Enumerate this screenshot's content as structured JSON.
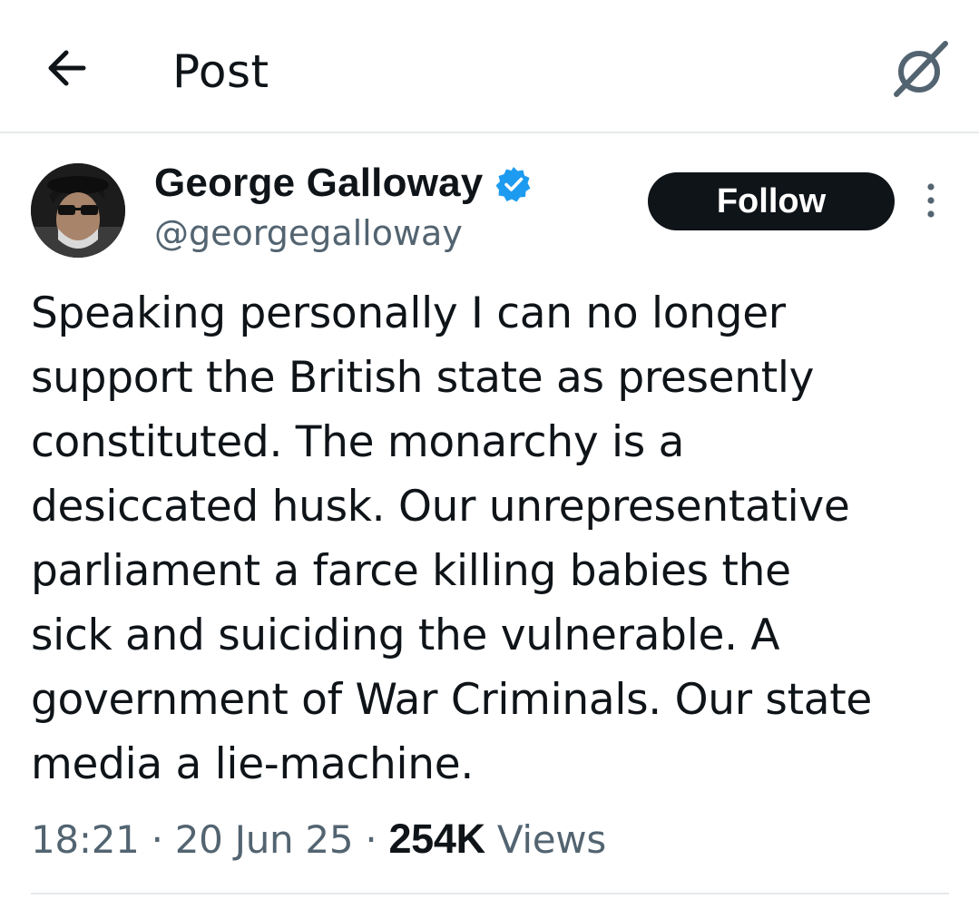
{
  "header": {
    "title": "Post",
    "back_icon": "arrow-left-icon",
    "grok_icon": "grok-icon"
  },
  "author": {
    "display_name": "George Galloway",
    "handle": "@georgegalloway",
    "verified": true,
    "verified_color": "#1d9bf0"
  },
  "actions": {
    "follow_label": "Follow",
    "more_icon": "more-vertical-icon"
  },
  "tweet": {
    "text": "Speaking personally I can no longer\nsupport the British state as presently\nconstituted. The monarchy is a\ndesiccated husk. Our unrepresentative\nparliament a farce killing babies the\nsick and suiciding the vulnerable. A\ngovernment of War Criminals. Our state\nmedia a lie-machine."
  },
  "meta": {
    "time": "18:21",
    "separator": "·",
    "date": "20 Jun 25",
    "views_count": "254K",
    "views_label": "Views"
  },
  "colors": {
    "text_primary": "#0f1419",
    "text_secondary": "#536471",
    "divider": "#e6e9eb",
    "button_bg": "#0f1419"
  }
}
